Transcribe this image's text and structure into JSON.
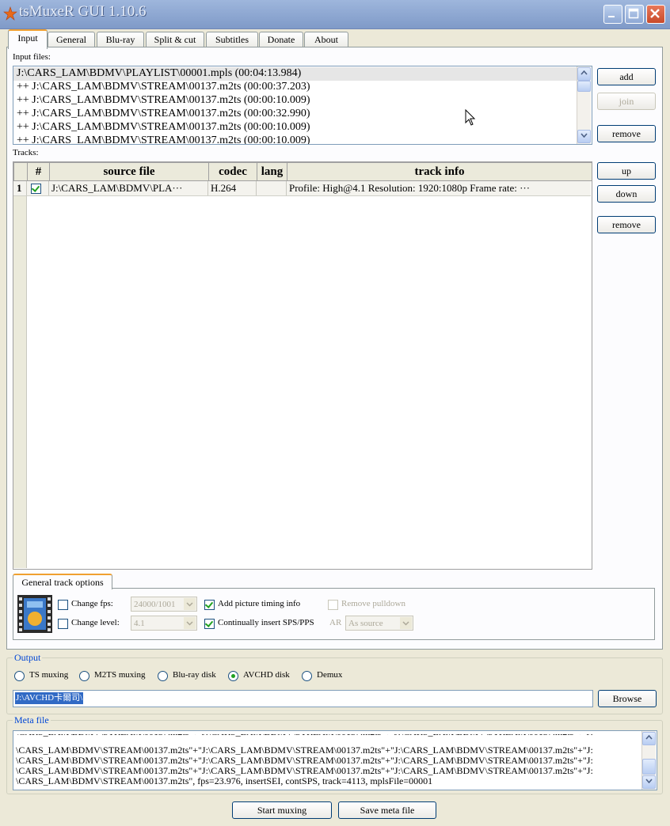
{
  "window": {
    "title": "tsMuxeR GUI 1.10.6"
  },
  "tabs": [
    {
      "label": "Input"
    },
    {
      "label": "General"
    },
    {
      "label": "Blu-ray"
    },
    {
      "label": "Split & cut"
    },
    {
      "label": "Subtitles"
    },
    {
      "label": "Donate"
    },
    {
      "label": "About"
    }
  ],
  "input": {
    "label": "Input files:",
    "files": [
      "J:\\CARS_LAM\\BDMV\\PLAYLIST\\00001.mpls (00:04:13.984)",
      "++ J:\\CARS_LAM\\BDMV\\STREAM\\00137.m2ts (00:00:37.203)",
      "++ J:\\CARS_LAM\\BDMV\\STREAM\\00137.m2ts (00:00:10.009)",
      "++ J:\\CARS_LAM\\BDMV\\STREAM\\00137.m2ts (00:00:32.990)",
      "++ J:\\CARS_LAM\\BDMV\\STREAM\\00137.m2ts (00:00:10.009)",
      "++ J:\\CARS_LAM\\BDMV\\STREAM\\00137.m2ts (00:00:10.009)"
    ],
    "buttons": {
      "add": "add",
      "join": "join",
      "remove": "remove"
    }
  },
  "tracks": {
    "label": "Tracks:",
    "headers": {
      "num": "#",
      "source": "source file",
      "codec": "codec",
      "lang": "lang",
      "info": "track info"
    },
    "rows": [
      {
        "num": "1",
        "source": "J:\\CARS_LAM\\BDMV\\PLA···",
        "codec": "H.264",
        "lang": "",
        "info": "Profile: High@4.1  Resolution: 1920:1080p  Frame rate: ···"
      }
    ],
    "buttons": {
      "up": "up",
      "down": "down",
      "remove": "remove"
    }
  },
  "track_options": {
    "tab_label": "General track options",
    "change_fps": "Change fps:",
    "fps_value": "24000/1001",
    "change_level": "Change level:",
    "level_value": "4.1",
    "add_timing": "Add picture timing info",
    "insert_sps": "Continually insert SPS/PPS",
    "remove_pulldown": "Remove pulldown",
    "ar_label": "AR",
    "ar_value": "As source"
  },
  "output": {
    "title": "Output",
    "options": [
      "TS muxing",
      "M2TS muxing",
      "Blu-ray disk",
      "AVCHD disk",
      "Demux"
    ],
    "selected": "AVCHD disk",
    "path": "J:\\AVCHD卡爾司\\",
    "browse": "Browse"
  },
  "meta": {
    "title": "Meta file",
    "lines": [
      "\\CARS_LAM\\BDMV\\STREAM\\00137.m2ts\"+\"J:\\CARS_LAM\\BDMV\\STREAM\\00137.m2ts\"+\"J:\\CARS_LAM\\BDMV\\STREAM\\00137.m2ts\"+\"J:",
      "\\CARS_LAM\\BDMV\\STREAM\\00137.m2ts\"+\"J:\\CARS_LAM\\BDMV\\STREAM\\00137.m2ts\"+\"J:\\CARS_LAM\\BDMV\\STREAM\\00137.m2ts\"+\"J:",
      "\\CARS_LAM\\BDMV\\STREAM\\00137.m2ts\"+\"J:\\CARS_LAM\\BDMV\\STREAM\\00137.m2ts\"+\"J:\\CARS_LAM\\BDMV\\STREAM\\00137.m2ts\"+\"J:",
      "\\CARS_LAM\\BDMV\\STREAM\\00137.m2ts\"+\"J:\\CARS_LAM\\BDMV\\STREAM\\00137.m2ts\"+\"J:\\CARS_LAM\\BDMV\\STREAM\\00137.m2ts\"+\"J:",
      "\\CARS_LAM\\BDMV\\STREAM\\00137.m2ts\", fps=23.976, insertSEI, contSPS, track=4113, mplsFile=00001"
    ]
  },
  "footer": {
    "start": "Start muxing",
    "save": "Save meta file"
  }
}
